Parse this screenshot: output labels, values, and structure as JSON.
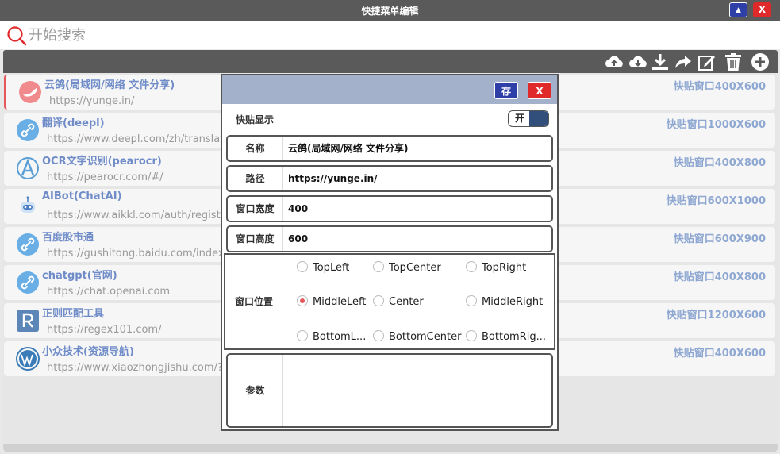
{
  "window": {
    "title": "快捷菜单编辑",
    "up_label": "▲",
    "close_label": "X"
  },
  "search": {
    "placeholder": "开始搜索"
  },
  "toolbar": {
    "icons": [
      "cloud-upload-icon",
      "cloud-download-icon",
      "download-icon",
      "share-icon",
      "edit-icon",
      "trash-icon",
      "add-icon"
    ]
  },
  "items": [
    {
      "title": "云鸽(局域网/网络 文件分享)",
      "url": "https://yunge.in/",
      "size": "快贴窗口400X600",
      "icon": "pigeon-icon"
    },
    {
      "title": "翻译(deepl)",
      "url": "https://www.deepl.com/zh/translator",
      "size": "快贴窗口1000X600",
      "icon": "link-icon"
    },
    {
      "title": "OCR文字识别(pearocr)",
      "url": "https://pearocr.com/#/",
      "size": "快贴窗口400X800",
      "icon": "ocr-icon"
    },
    {
      "title": "AIBot(ChatAI)",
      "url": "https://www.aikkl.com/auth/register",
      "size": "快贴窗口600X1000",
      "icon": "robot-icon"
    },
    {
      "title": "百度股市通",
      "url": "https://gushitong.baidu.com/index",
      "size": "快贴窗口600X900",
      "icon": "link-icon"
    },
    {
      "title": "chatgpt(官网)",
      "url": "https://chat.openai.com",
      "size": "快贴窗口400X800",
      "icon": "link-icon"
    },
    {
      "title": "正则匹配工具",
      "url": "https://regex101.com/",
      "size": "快贴窗口1200X600",
      "icon": "regex-icon"
    },
    {
      "title": "小众技术(资源导航)",
      "url": "https://www.xiaozhongjishu.com/?f",
      "size": "快贴窗口400X600",
      "icon": "wordpress-icon"
    }
  ],
  "dialog": {
    "save_label": "存",
    "close_label": "X",
    "toggle_label": "快贴显示",
    "toggle_value": "开",
    "name_label": "名称",
    "name_value": "云鸽(局域网/网络 文件分享)",
    "path_label": "路径",
    "path_value": "https://yunge.in/",
    "width_label": "窗口宽度",
    "width_value": "400",
    "height_label": "窗口高度",
    "height_value": "600",
    "position_label": "窗口位置",
    "positions": [
      "TopLeft",
      "TopCenter",
      "TopRight",
      "MiddleLeft",
      "Center",
      "MiddleRight",
      "BottomL...",
      "BottomCenter",
      "BottomRig..."
    ],
    "selected_position": "MiddleLeft",
    "param_label": "参数",
    "param_value": ""
  },
  "colors": {
    "accent": "#2f3fa8",
    "danger": "#e0292b",
    "title_text": "#6f8cc8",
    "header": "#a3b1cb"
  }
}
